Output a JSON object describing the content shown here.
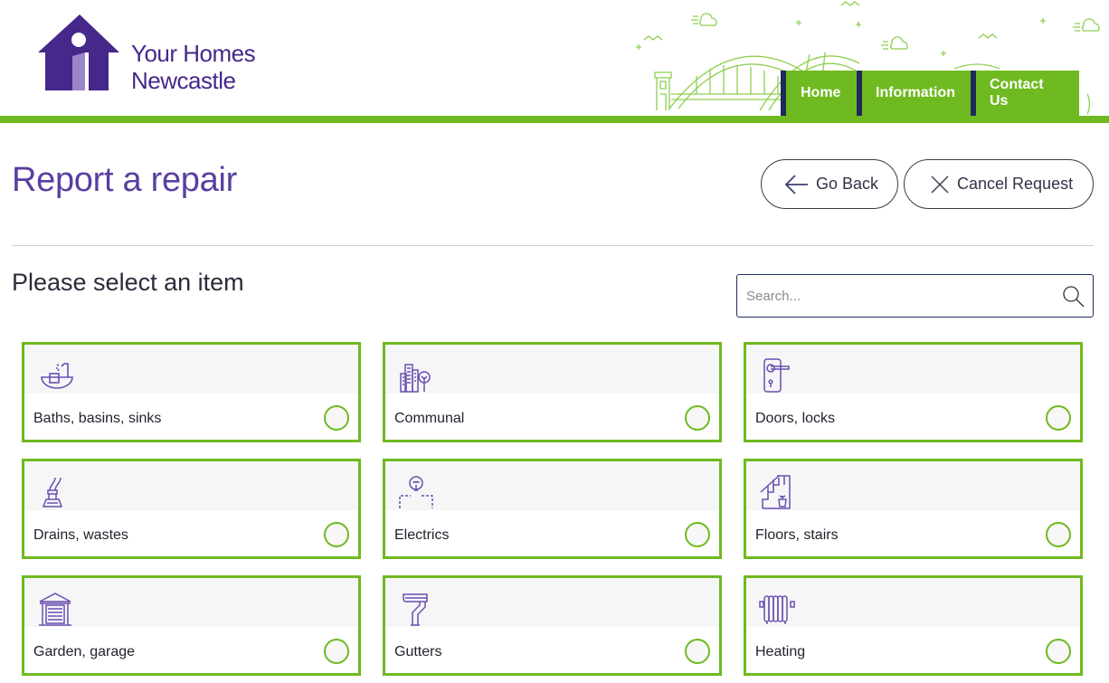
{
  "brand": {
    "line1": "Your Homes",
    "line2": "Newcastle",
    "primary_color": "#46278a",
    "accent_color": "#6fba20",
    "nav_divider_color": "#1f2a5c"
  },
  "nav": {
    "items": [
      {
        "label": "Home"
      },
      {
        "label": "Information"
      },
      {
        "label": "Contact Us"
      }
    ]
  },
  "page": {
    "title": "Report a repair",
    "subtitle": "Please select an item"
  },
  "actions": {
    "back_label": "Go Back",
    "cancel_label": "Cancel Request"
  },
  "search": {
    "placeholder": "Search...",
    "value": ""
  },
  "items": [
    {
      "label": "Baths, basins, sinks",
      "icon": "bath-icon",
      "selected": false
    },
    {
      "label": "Communal",
      "icon": "building-tree-icon",
      "selected": false
    },
    {
      "label": "Doors, locks",
      "icon": "door-handle-icon",
      "selected": false
    },
    {
      "label": "Drains, wastes",
      "icon": "drain-pipe-icon",
      "selected": false
    },
    {
      "label": "Electrics",
      "icon": "light-bulb-icon",
      "selected": false
    },
    {
      "label": "Floors, stairs",
      "icon": "stairs-icon",
      "selected": false
    },
    {
      "label": "Garden, garage",
      "icon": "garage-icon",
      "selected": false
    },
    {
      "label": "Gutters",
      "icon": "gutter-icon",
      "selected": false
    },
    {
      "label": "Heating",
      "icon": "radiator-icon",
      "selected": false
    }
  ]
}
